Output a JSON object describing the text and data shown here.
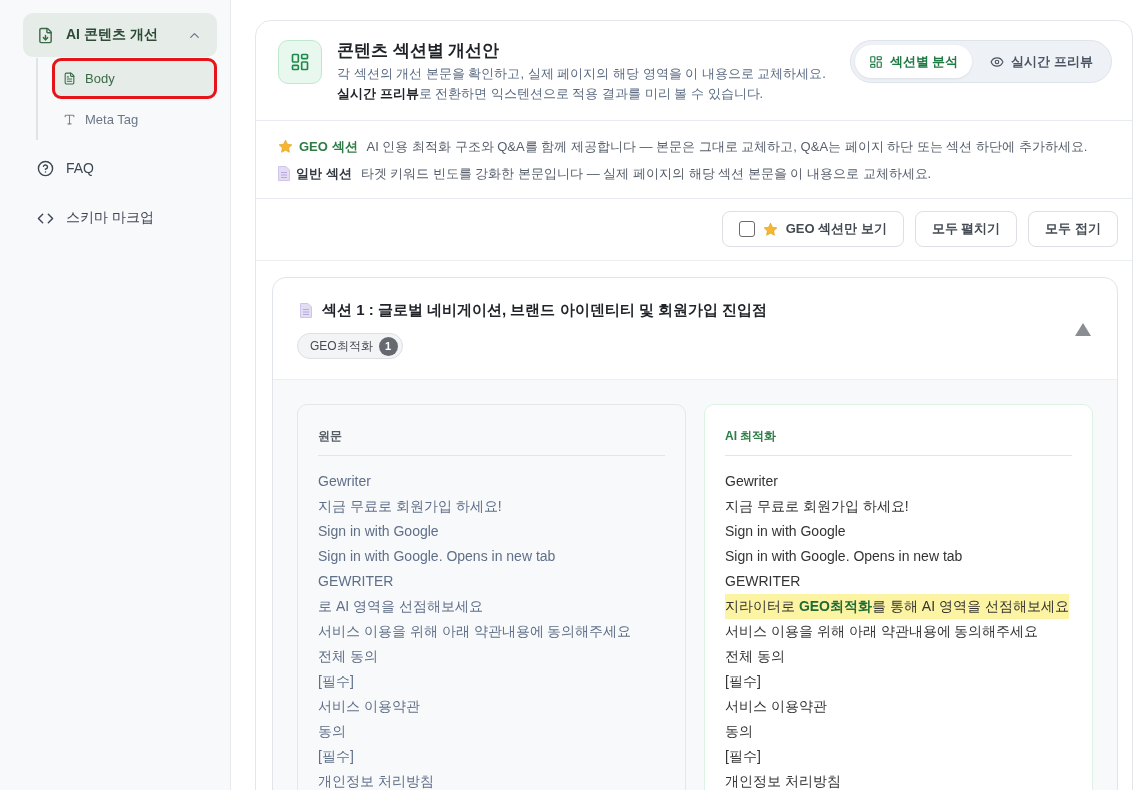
{
  "sidebar": {
    "items": [
      {
        "kind": "group",
        "label": "AI 콘텐츠 개선",
        "expanded": true,
        "children": [
          {
            "label": "Body",
            "selected": true,
            "outlined": true
          },
          {
            "label": "Meta Tag",
            "selected": false,
            "outlined": false
          }
        ]
      },
      {
        "kind": "link",
        "label": "FAQ"
      },
      {
        "kind": "link",
        "label": "스키마 마크업"
      }
    ]
  },
  "header": {
    "title": "콘텐츠 섹션별 개선안",
    "description": [
      "각 섹션의 개선 본문을 확인하고, 실제 페이지의 해당 영역을 이 내용으로 교체하세요.",
      "**실시간 프리뷰**로 전환하면 익스텐션으로 적용 결과를 미리 볼 수 있습니다."
    ],
    "view_tabs": [
      {
        "label": "섹션별 분석",
        "selected": true
      },
      {
        "label": "실시간 프리뷰",
        "selected": false
      }
    ]
  },
  "legend": [
    {
      "kind": "geo",
      "label": "GEO 섹션",
      "text": "AI 인용 최적화 구조와 Q&A를 함께 제공합니다 — 본문은 그대로 교체하고, Q&A는 페이지 하단 또는 섹션 하단에 추가하세요."
    },
    {
      "kind": "general",
      "label": "일반 섹션",
      "text": "타겟 키워드 빈도를 강화한 본문입니다 — 실제 페이지의 해당 섹션 본문을 이 내용으로 교체하세요."
    }
  ],
  "toolbar": {
    "geo_filter": {
      "label": "GEO 섹션만 보기",
      "checked": false
    },
    "buttons": [
      "모두 펼치기",
      "모두 접기"
    ]
  },
  "sections": [
    {
      "kind": "general",
      "title": "섹션 1 : 글로벌 네비게이션, 브랜드 아이덴티티 및 회원가입 진입점",
      "expanded": true,
      "badge": {
        "label": "GEO최적화",
        "count": "1"
      },
      "original": {
        "heading": "원문",
        "lines": [
          "Gewriter",
          "지금 무료로 회원가입 하세요!",
          "Sign in with Google",
          "Sign in with Google. Opens in new tab",
          "GEWRITER",
          "로 AI 영역을 선점해보세요",
          "서비스 이용을 위해 아래 약관내용에 동의해주세요",
          "전체 동의",
          "[필수]",
          "서비스 이용약관",
          "동의",
          "[필수]",
          "개인정보 처리방침"
        ]
      },
      "optimized": {
        "heading": "AI 최적화",
        "lines": [
          {
            "text": "Gewriter",
            "highlighted": false
          },
          {
            "text": "지금 무료로 회원가입 하세요!",
            "highlighted": false
          },
          {
            "text": "Sign in with Google",
            "highlighted": false
          },
          {
            "text": "Sign in with Google. Opens in new tab",
            "highlighted": false
          },
          {
            "text": "GEWRITER",
            "highlighted": false
          },
          {
            "text": "지라이터로 **GEO최적화**를 통해 AI 영역을 선점해보세요",
            "highlighted": true
          },
          {
            "text": "서비스 이용을 위해 아래 약관내용에 동의해주세요",
            "highlighted": false
          },
          {
            "text": "전체 동의",
            "highlighted": false
          },
          {
            "text": "[필수]",
            "highlighted": false
          },
          {
            "text": "서비스 이용약관",
            "highlighted": false
          },
          {
            "text": "동의",
            "highlighted": false
          },
          {
            "text": "[필수]",
            "highlighted": false
          },
          {
            "text": "개인정보 처리방침",
            "highlighted": false
          }
        ]
      }
    }
  ]
}
